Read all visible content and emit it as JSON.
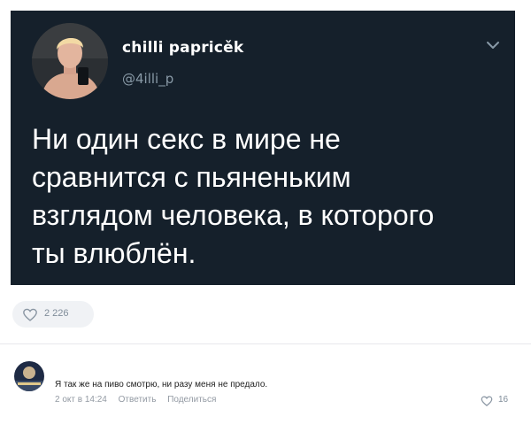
{
  "tweet": {
    "display_name": "chilli papricěk",
    "handle": "@4illi_p",
    "text_lines": [
      "Ни один секс в мире не",
      "сравнится с пьяненьким",
      "взглядом человека, в которого",
      "ты влюблён."
    ],
    "menu_icon": "chevron-down-icon",
    "background_color": "#15202b"
  },
  "post": {
    "like_count": "2 226",
    "like_icon": "heart-outline-icon"
  },
  "comment": {
    "text": "Я так же на пиво смотрю, ни разу меня не предало.",
    "timestamp": "2 окт в 14:24",
    "reply_label": "Ответить",
    "share_label": "Поделиться",
    "like_count": "16",
    "like_icon": "heart-outline-icon"
  },
  "colors": {
    "tweet_background": "#15202b",
    "handle_text": "#8899a6",
    "meta_text": "#939aa3",
    "like_pill_background": "#f0f2f5"
  }
}
